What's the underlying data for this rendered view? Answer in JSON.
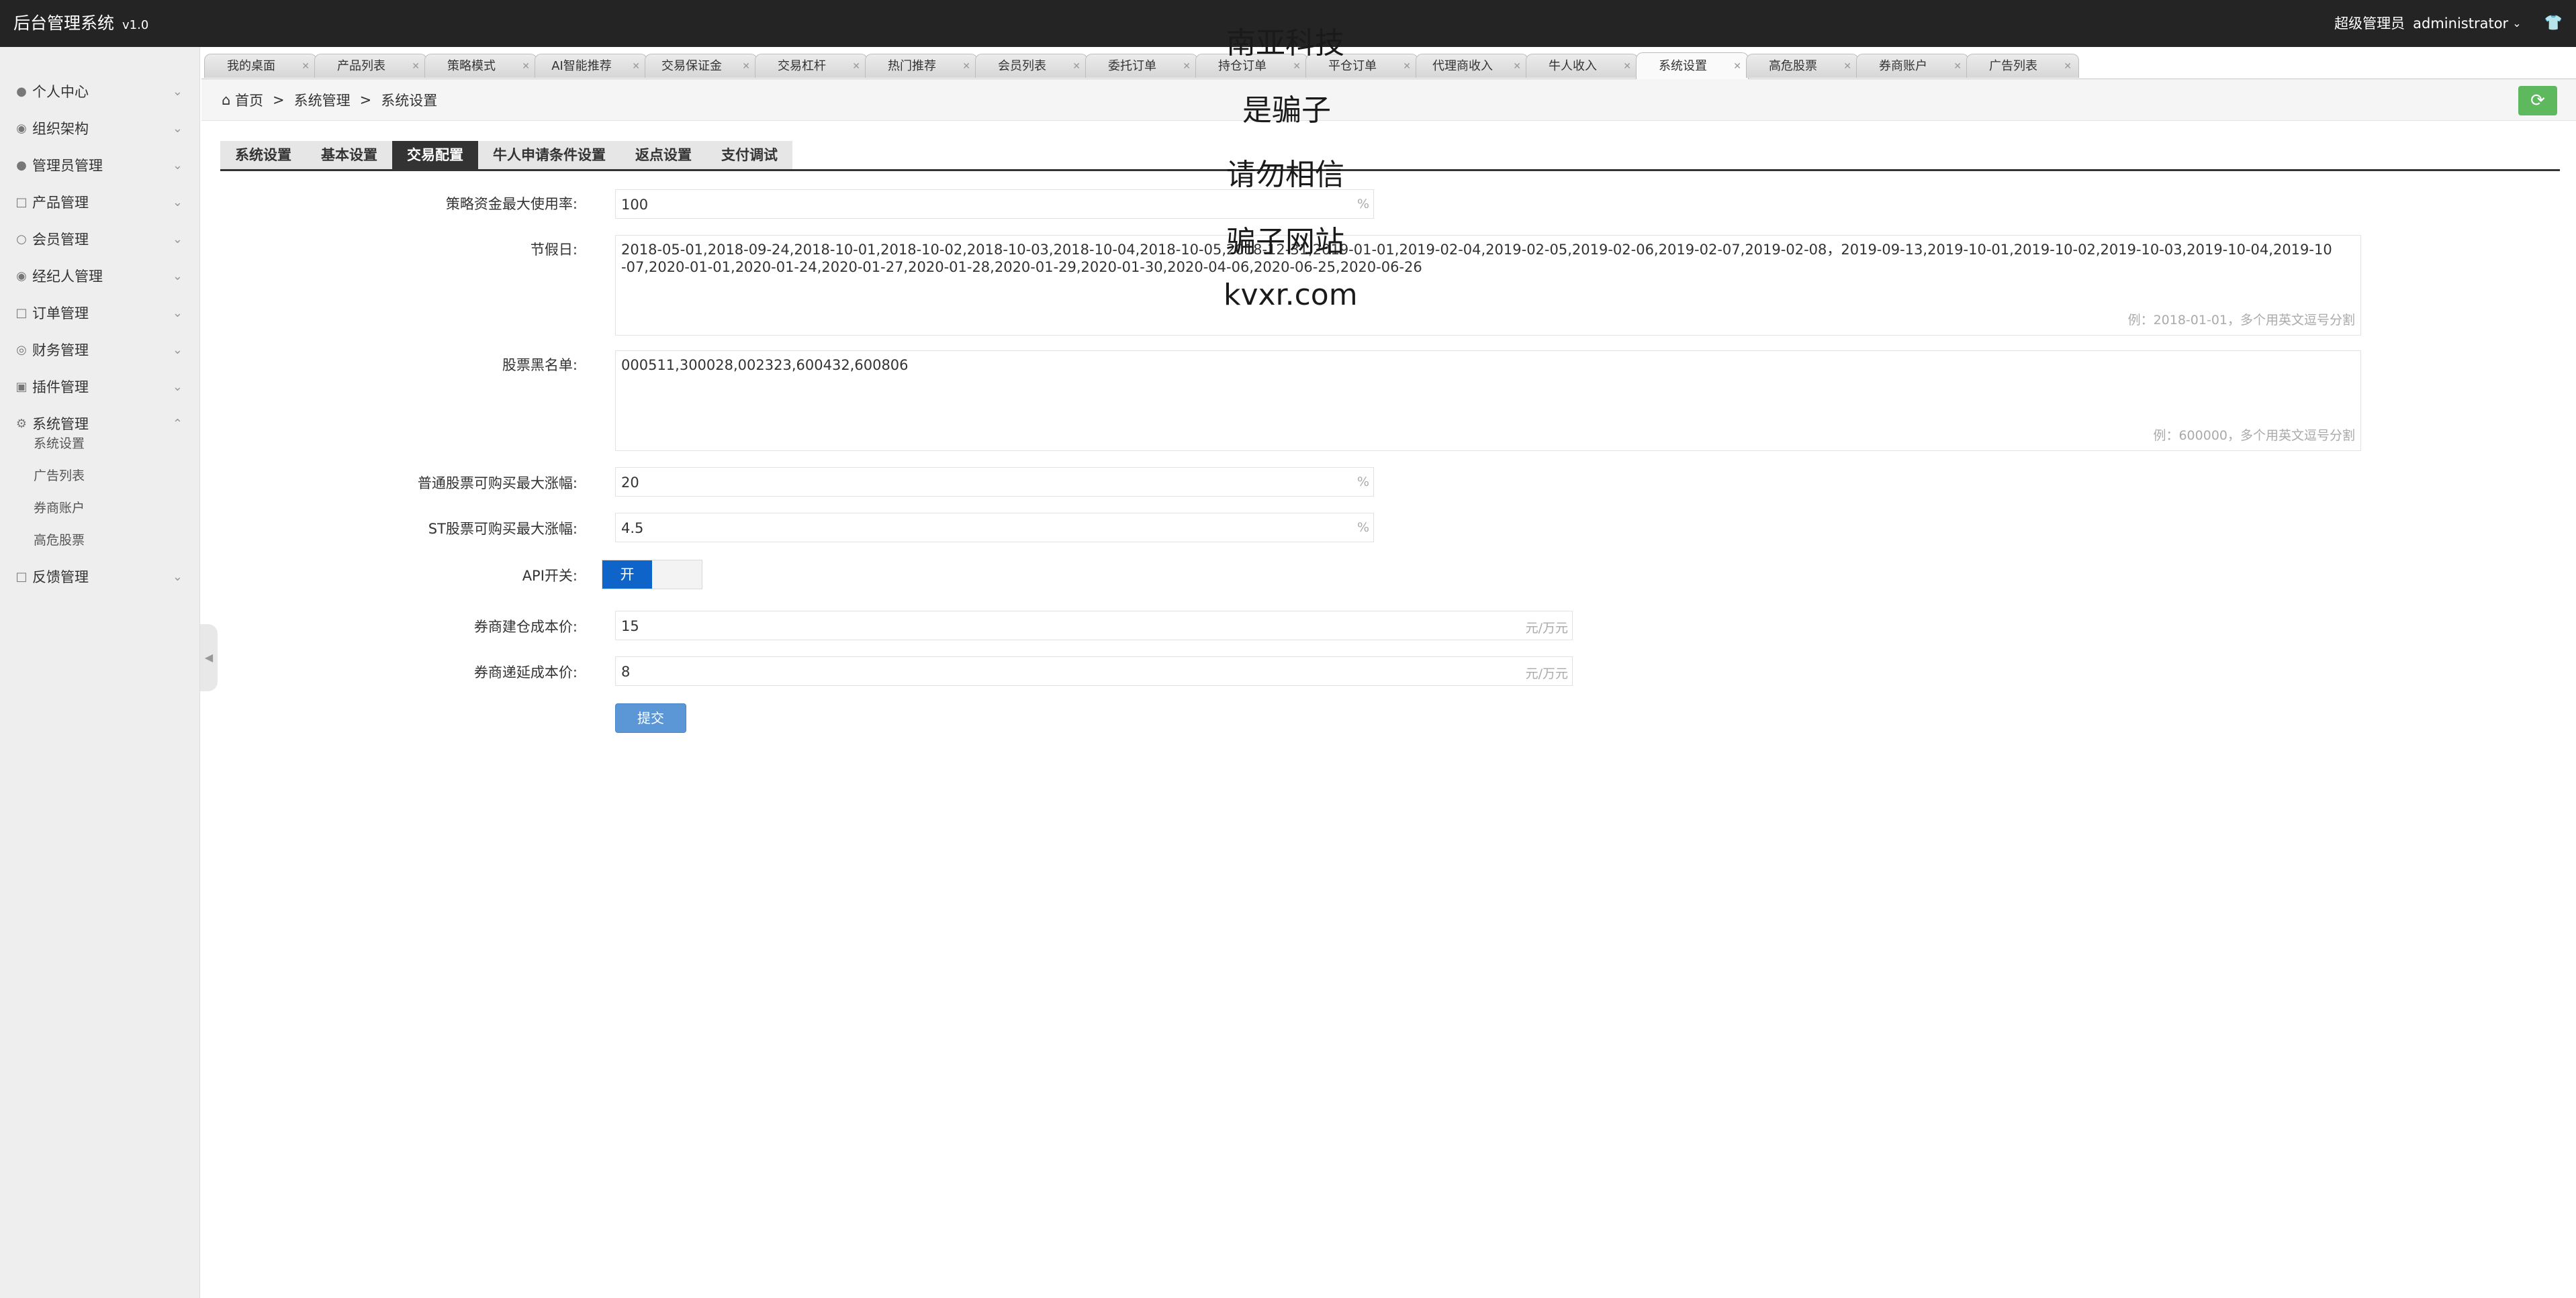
{
  "topbar": {
    "brand": "后台管理系统",
    "version": "v1.0",
    "role": "超级管理员",
    "user": "administrator"
  },
  "sidebar": {
    "items": [
      {
        "label": "个人中心",
        "icon": "user-icon"
      },
      {
        "label": "组织架构",
        "icon": "org-icon"
      },
      {
        "label": "管理员管理",
        "icon": "admin-icon"
      },
      {
        "label": "产品管理",
        "icon": "product-icon"
      },
      {
        "label": "会员管理",
        "icon": "member-icon"
      },
      {
        "label": "经纪人管理",
        "icon": "broker-icon"
      },
      {
        "label": "订单管理",
        "icon": "order-icon"
      },
      {
        "label": "财务管理",
        "icon": "finance-icon"
      },
      {
        "label": "插件管理",
        "icon": "plugin-icon"
      },
      {
        "label": "系统管理",
        "icon": "gear-icon"
      },
      {
        "label": "反馈管理",
        "icon": "feedback-icon"
      }
    ],
    "subitems": [
      "系统设置",
      "广告列表",
      "券商账户",
      "高危股票"
    ]
  },
  "tabs": [
    "我的桌面",
    "产品列表",
    "策略模式",
    "AI智能推荐",
    "交易保证金",
    "交易杠杆",
    "热门推荐",
    "会员列表",
    "委托订单",
    "持仓订单",
    "平仓订单",
    "代理商收入",
    "牛人收入",
    "系统设置",
    "高危股票",
    "券商账户",
    "广告列表"
  ],
  "active_tab": "系统设置",
  "breadcrumb": {
    "home": "首页",
    "sep": ">",
    "level1": "系统管理",
    "level2": "系统设置"
  },
  "subtabs": [
    "系统设置",
    "基本设置",
    "交易配置",
    "牛人申请条件设置",
    "返点设置",
    "支付调试"
  ],
  "active_subtab": "交易配置",
  "form": {
    "max_rate": {
      "label": "策略资金最大使用率:",
      "value": "100",
      "unit": "%"
    },
    "holidays": {
      "label": "节假日:",
      "value": "2018-05-01,2018-09-24,2018-10-01,2018-10-02,2018-10-03,2018-10-04,2018-10-05,2018-12-31,2019-01-01,2019-02-04,2019-02-05,2019-02-06,2019-02-07,2019-02-08，2019-09-13,2019-10-01,2019-10-02,2019-10-03,2019-10-04,2019-10-07,2020-01-01,2020-01-24,2020-01-27,2020-01-28,2020-01-29,2020-01-30,2020-04-06,2020-06-25,2020-06-26",
      "hint": "例：2018-01-01，多个用英文逗号分割"
    },
    "blacklist": {
      "label": "股票黑名单:",
      "value": "000511,300028,002323,600432,600806",
      "hint": "例：600000，多个用英文逗号分割"
    },
    "normal_limit": {
      "label": "普通股票可购买最大涨幅:",
      "value": "20",
      "unit": "%"
    },
    "st_limit": {
      "label": "ST股票可购买最大涨幅:",
      "value": "4.5",
      "unit": "%"
    },
    "api_switch": {
      "label": "API开关:",
      "on_text": "开"
    },
    "open_cost": {
      "label": "券商建仓成本价:",
      "value": "15",
      "unit": "元/万元"
    },
    "defer_cost": {
      "label": "券商递延成本价:",
      "value": "8",
      "unit": "元/万元"
    },
    "submit": "提交"
  },
  "watermark": [
    "南亚科技",
    "是骗子",
    "请勿相信",
    "骗子网站",
    "kvxr.com"
  ]
}
